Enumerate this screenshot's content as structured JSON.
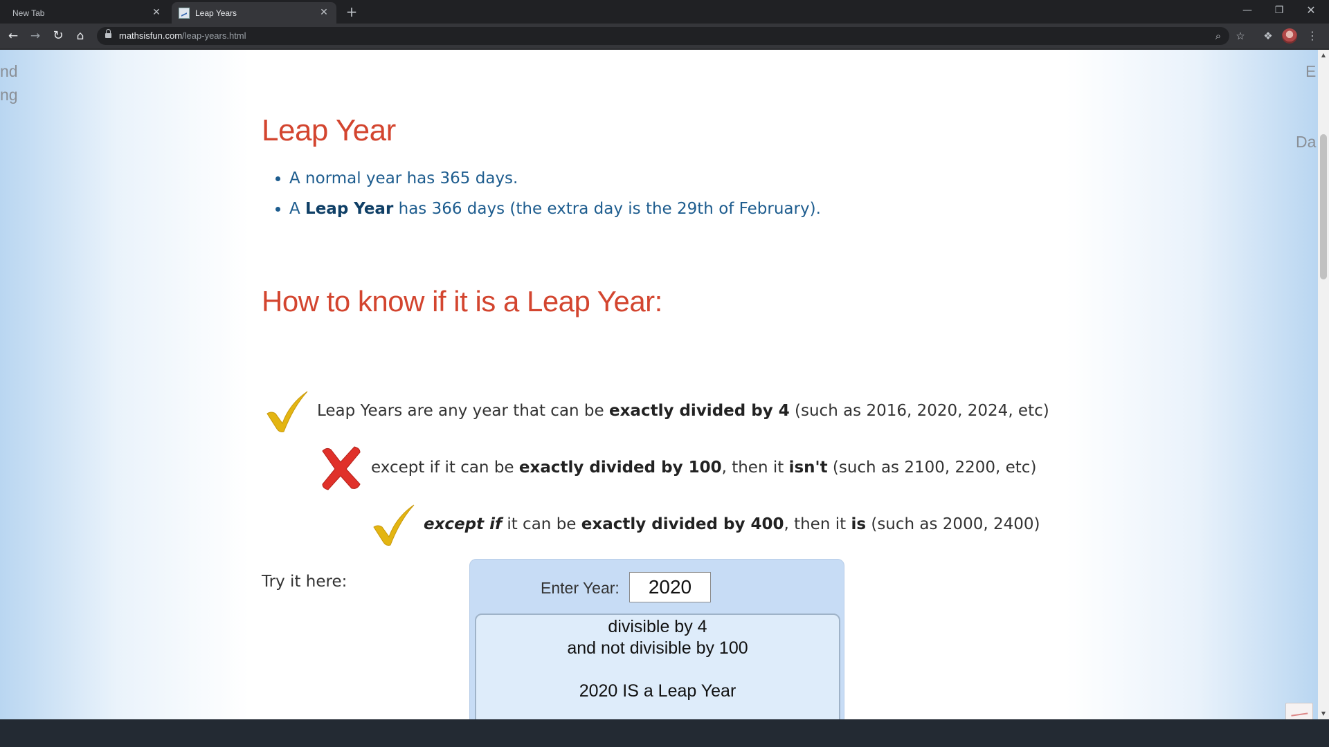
{
  "browser": {
    "tabs": [
      {
        "title": "New Tab",
        "active": false
      },
      {
        "title": "Leap Years",
        "active": true
      }
    ],
    "new_tab_symbol": "+",
    "close_symbol": "✕",
    "url_host": "mathsisfun.com",
    "url_path": "/leap-years.html",
    "icons": [
      "back-arrow-icon",
      "forward-arrow-icon",
      "reload-icon",
      "home-icon",
      "lock-icon",
      "zoom-icon",
      "star-icon",
      "puzzle-piece-icon",
      "profile-avatar",
      "kebab-menu-icon",
      "minimize-icon",
      "maximize-icon",
      "close-icon"
    ]
  },
  "page": {
    "edge_left": [
      "nd",
      "ng"
    ],
    "edge_right": [
      "E",
      "Da"
    ],
    "title": "Leap Year",
    "facts": {
      "normal_text": "A normal year has 365 days.",
      "leap_prefix": "A ",
      "leap_bold": "Leap Year",
      "leap_suffix": " has 366 days (the extra day is the 29th of February)."
    },
    "how_to_title": "How to know if it is a Leap Year:",
    "rules": [
      {
        "mark": "check",
        "pre": "Leap Years are any year that can be ",
        "bold": "exactly divided by 4",
        "post": " (such as 2016, 2020, 2024, etc)"
      },
      {
        "mark": "cross",
        "pre": "except if it can be ",
        "bold": "exactly divided by 100",
        "mid": ", then it ",
        "bold2": "isn't",
        "post": " (such as 2100, 2200, etc)"
      },
      {
        "mark": "check",
        "italic_bold": "except if",
        "pre": " it can be ",
        "bold": "exactly divided by 400",
        "mid": ", then it ",
        "bold2": "is",
        "post": " (such as 2000, 2400)"
      }
    ],
    "try_label": "Try it here:",
    "calculator": {
      "label": "Enter Year:",
      "year_value": "2020",
      "result_line1": "divisible by 4",
      "result_line2": "and not divisible by 100",
      "result_verdict": "2020 IS a Leap Year"
    }
  },
  "colors": {
    "heading": "#d3452f",
    "fact_text": "#1d5c8e",
    "check": "#e3b512",
    "cross": "#e0312a",
    "calculator_bg": "#c7dcf5"
  }
}
